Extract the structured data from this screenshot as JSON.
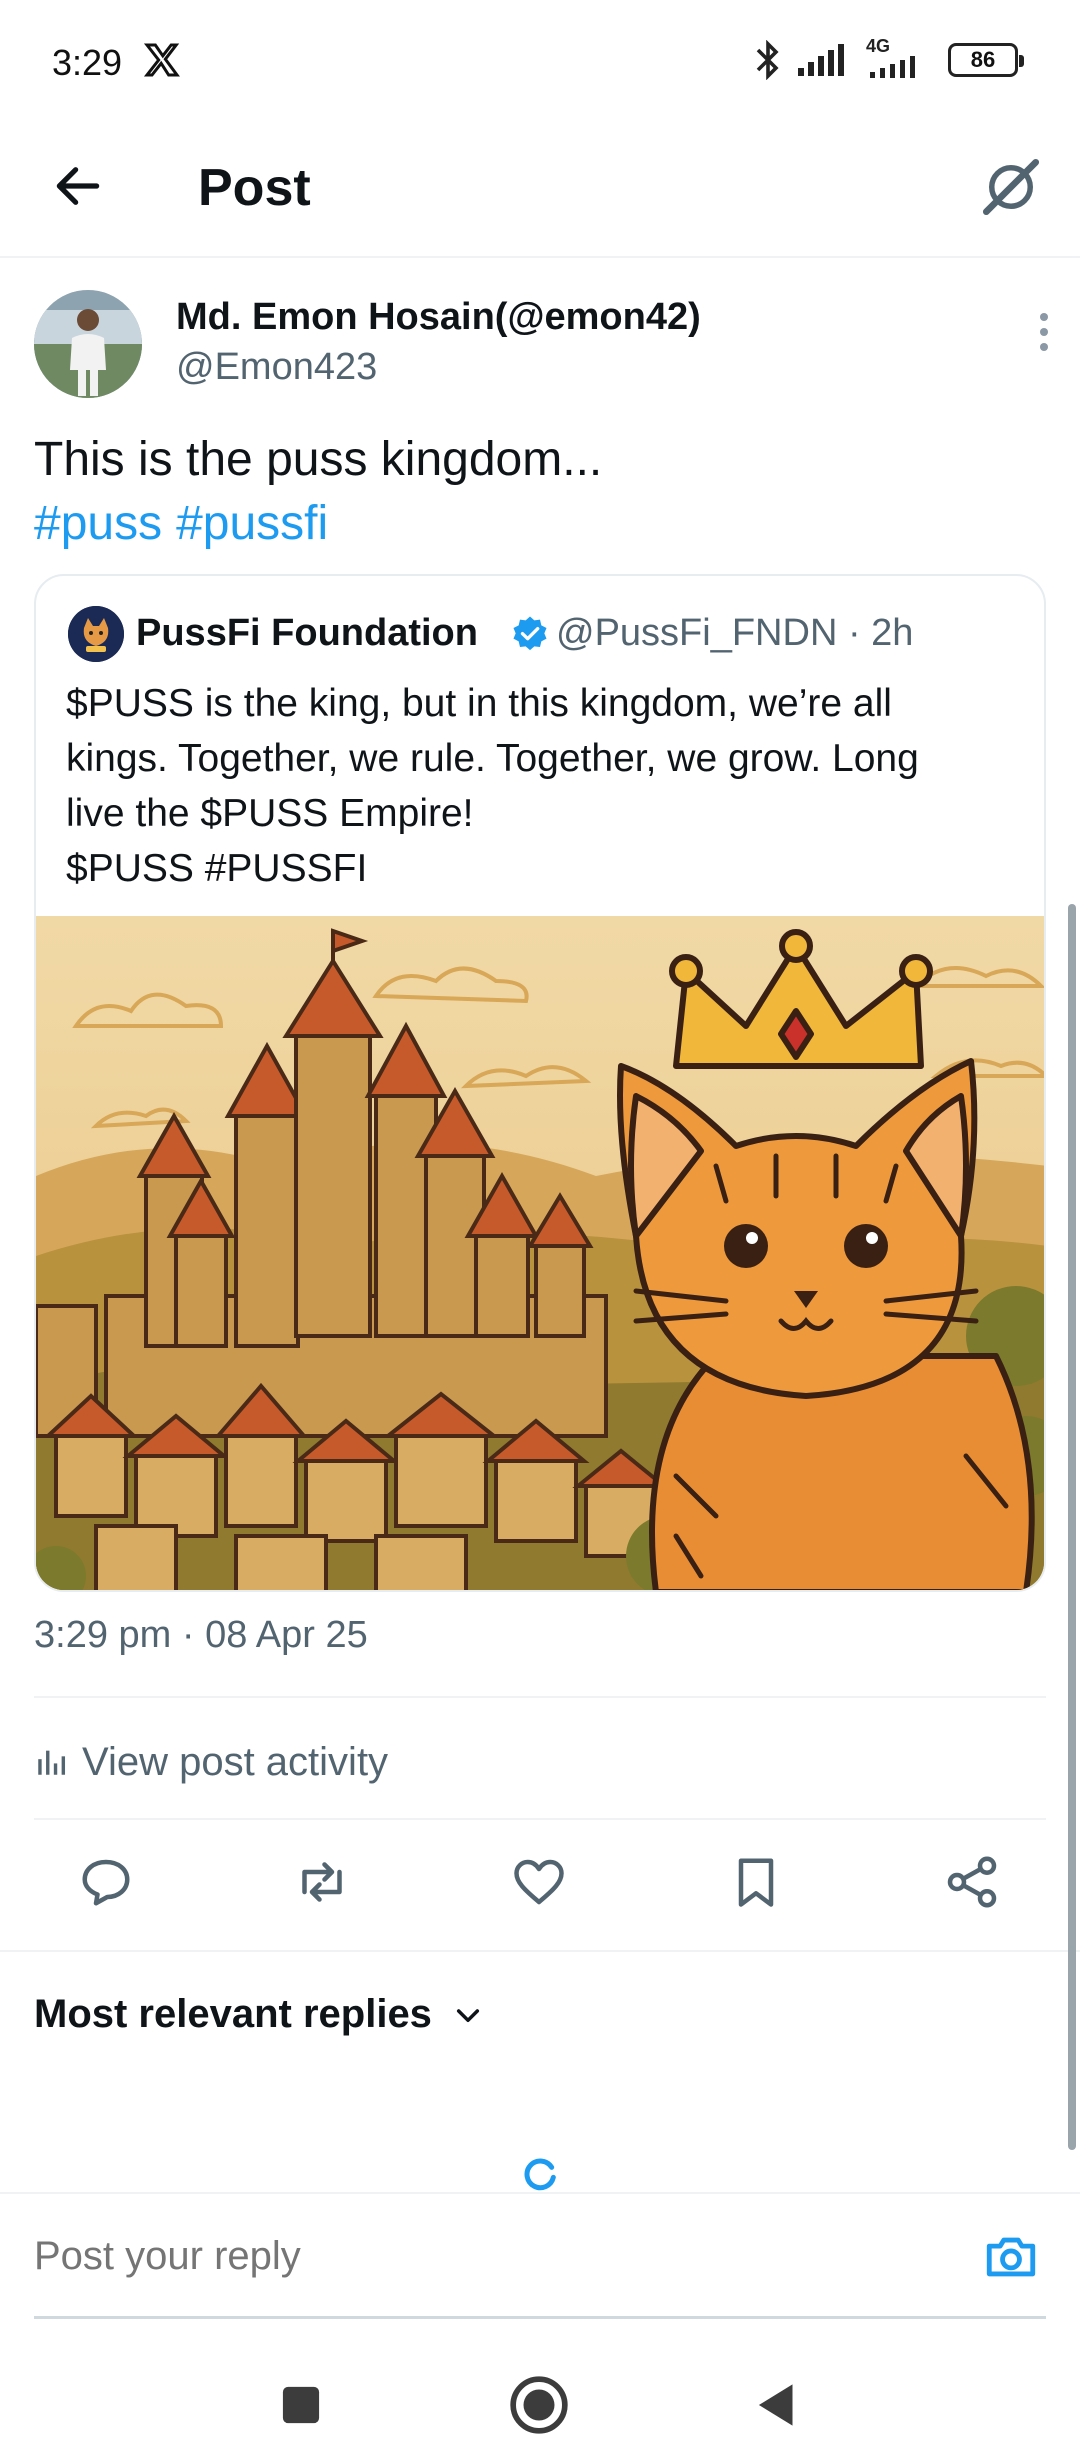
{
  "status_bar": {
    "time": "3:29",
    "network_label": "4G",
    "battery": "86"
  },
  "header": {
    "title": "Post"
  },
  "post": {
    "author_name": "Md. Emon Hosain(@emon42)",
    "author_handle": "@Emon423",
    "text": "This is the puss kingdom...",
    "hashtags": [
      "#puss",
      "#pussfi"
    ],
    "timestamp": "3:29 pm · 08 Apr 25"
  },
  "quote": {
    "author_name": "PussFi Foundation",
    "author_handle": "@PussFi_FNDN · 2h",
    "text_lines": [
      "$PUSS is the king, but in this kingdom,  we’re all",
      "kings. Together, we rule. Together, we grow. Long",
      "live the $PUSS Empire!",
      "$PUSS #PUSSFI"
    ]
  },
  "activity": {
    "label": "View post activity"
  },
  "actions": {
    "icons": [
      "reply-icon",
      "repost-icon",
      "like-icon",
      "bookmark-icon",
      "share-icon"
    ]
  },
  "replies": {
    "sort_label": "Most relevant replies"
  },
  "reply_bar": {
    "placeholder": "Post your reply"
  },
  "colors": {
    "accent": "#1d9bf0",
    "text": "#0f1419",
    "secondary": "#536471"
  }
}
